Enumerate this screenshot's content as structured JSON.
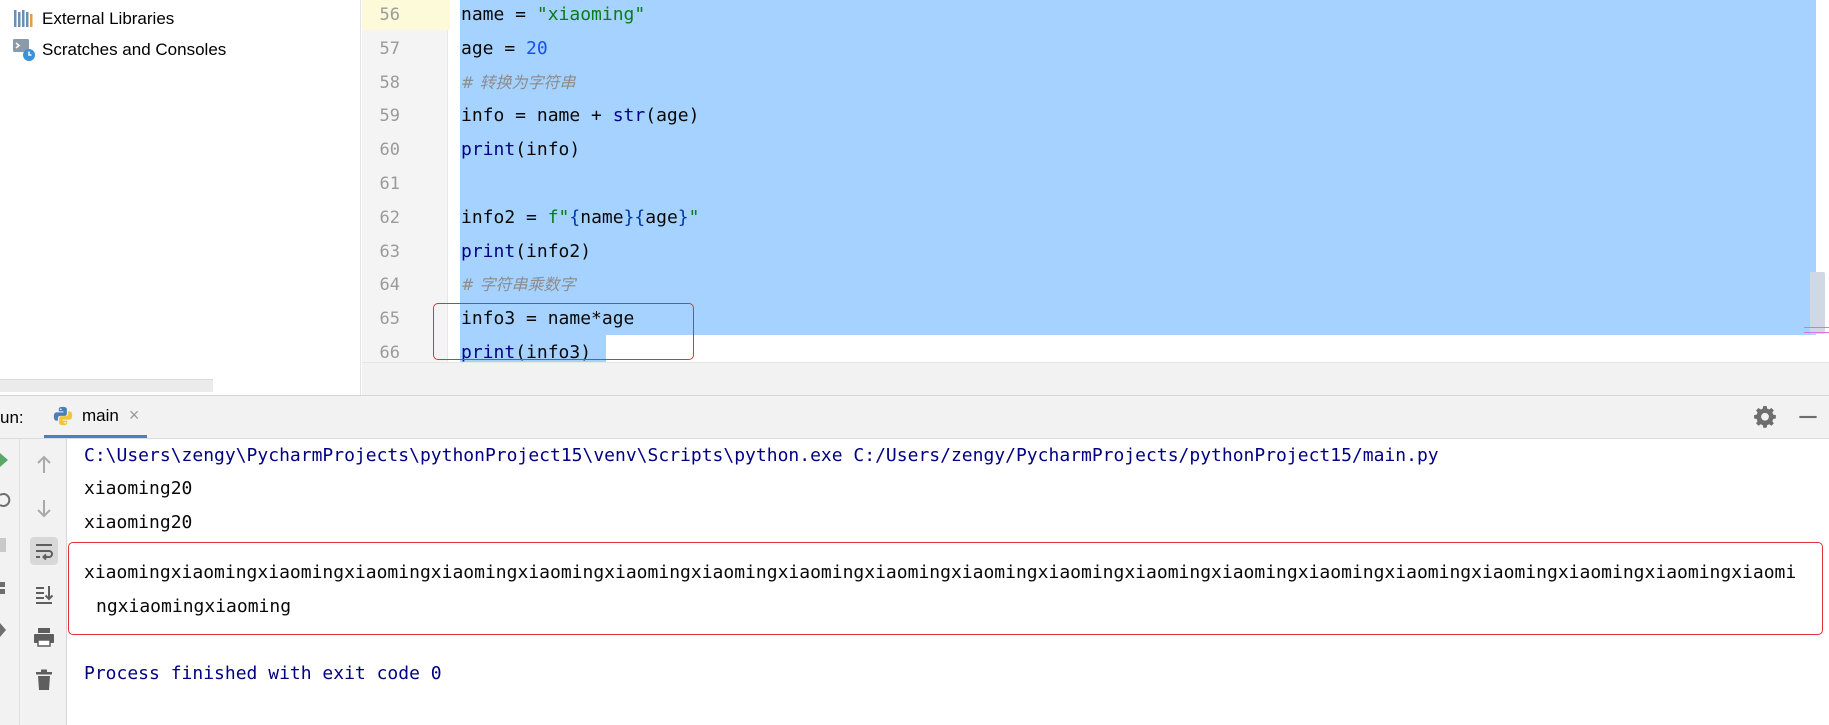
{
  "colors": {
    "selection": "#a6d2ff",
    "highlight_box": "#e0303a",
    "string": "#067d17",
    "number": "#1750eb",
    "comment": "#8c8c8c",
    "builtin": "#000080",
    "console_system": "#000080"
  },
  "project_tree": {
    "items": [
      {
        "label": "External Libraries",
        "icon": "library-icon"
      },
      {
        "label": "Scratches and Consoles",
        "icon": "scratches-icon"
      }
    ]
  },
  "editor": {
    "lines": [
      {
        "number": "56",
        "tokens": [
          {
            "t": "name = ",
            "k": ""
          },
          {
            "t": "\"xiaoming\"",
            "k": "str"
          }
        ]
      },
      {
        "number": "57",
        "tokens": [
          {
            "t": "age = ",
            "k": ""
          },
          {
            "t": "20",
            "k": "num"
          }
        ]
      },
      {
        "number": "58",
        "tokens": [
          {
            "t": "# 转换为字符串",
            "k": "cmt"
          }
        ]
      },
      {
        "number": "59",
        "tokens": [
          {
            "t": "info = name + ",
            "k": ""
          },
          {
            "t": "str",
            "k": "bi"
          },
          {
            "t": "(age)",
            "k": ""
          }
        ]
      },
      {
        "number": "60",
        "tokens": [
          {
            "t": "print",
            "k": "bi"
          },
          {
            "t": "(info)",
            "k": ""
          }
        ]
      },
      {
        "number": "61",
        "tokens": []
      },
      {
        "number": "62",
        "tokens": [
          {
            "t": "info2 = ",
            "k": ""
          },
          {
            "t": "f\"",
            "k": "str"
          },
          {
            "t": "{",
            "k": "brace"
          },
          {
            "t": "name",
            "k": ""
          },
          {
            "t": "}{",
            "k": "brace"
          },
          {
            "t": "age",
            "k": ""
          },
          {
            "t": "}",
            "k": "brace"
          },
          {
            "t": "\"",
            "k": "str"
          }
        ]
      },
      {
        "number": "63",
        "tokens": [
          {
            "t": "print",
            "k": "bi"
          },
          {
            "t": "(info2)",
            "k": ""
          }
        ]
      },
      {
        "number": "64",
        "tokens": [
          {
            "t": "# 字符串乘数字",
            "k": "cmt"
          }
        ]
      },
      {
        "number": "65",
        "tokens": [
          {
            "t": "info3 = name*age",
            "k": ""
          }
        ]
      },
      {
        "number": "66",
        "tokens": [
          {
            "t": "print",
            "k": "bi"
          },
          {
            "t": "(info3)",
            "k": ""
          }
        ]
      }
    ]
  },
  "run_window": {
    "label": "un:",
    "tab_label": "main",
    "console": {
      "command": "C:\\Users\\zengy\\PycharmProjects\\pythonProject15\\venv\\Scripts\\python.exe C:/Users/zengy/PycharmProjects/pythonProject15/main.py",
      "output1": "xiaoming20",
      "output2": "xiaoming20",
      "output3_line1": "xiaomingxiaomingxiaomingxiaomingxiaomingxiaomingxiaomingxiaomingxiaomingxiaomingxiaomingxiaomingxiaomingxiaomingxiaomingxiaomingxiaomingxiaomingxiaomingxiaomi",
      "output3_line2": "ngxiaomingxiaoming",
      "exit_message": "Process finished with exit code 0"
    }
  }
}
